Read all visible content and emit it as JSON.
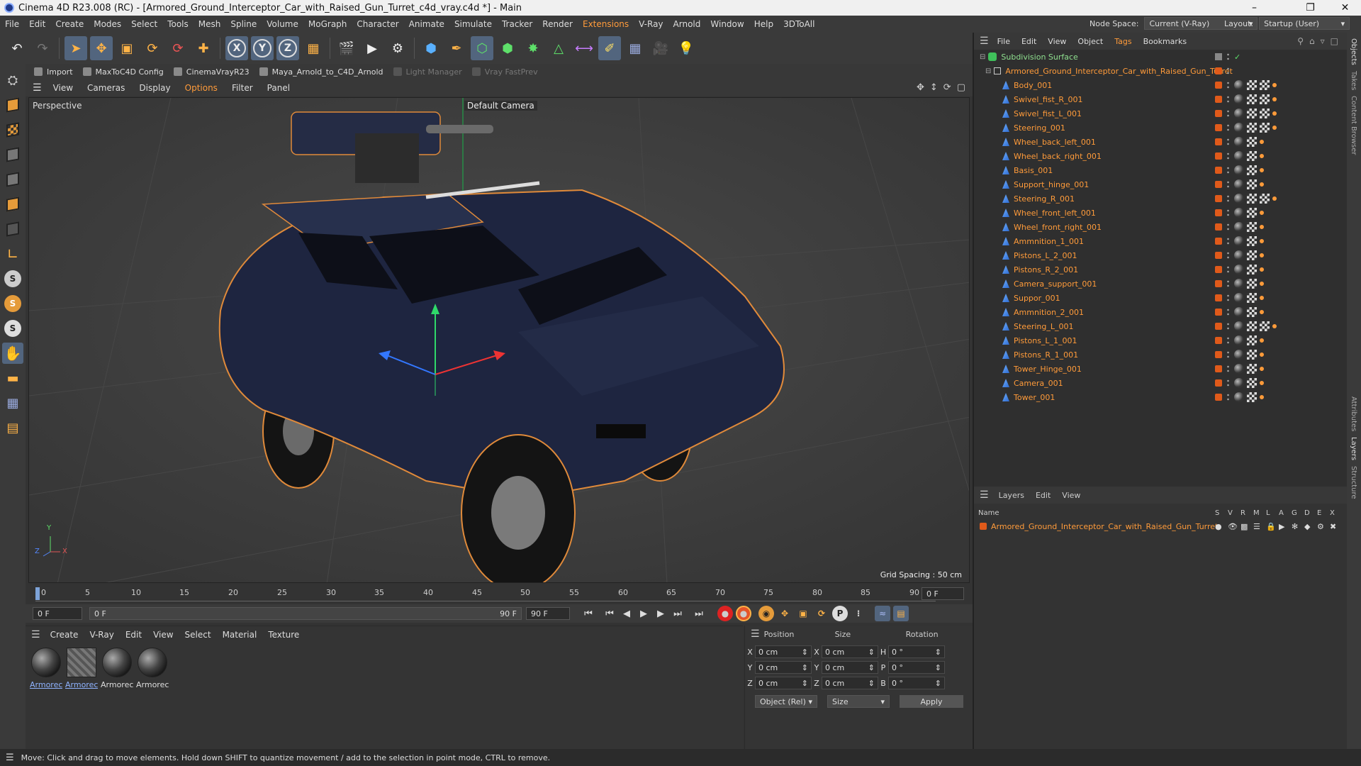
{
  "window": {
    "title": "Cinema 4D R23.008 (RC) - [Armored_Ground_Interceptor_Car_with_Raised_Gun_Turret_c4d_vray.c4d *] - Main"
  },
  "menubar": {
    "items": [
      {
        "label": "File"
      },
      {
        "label": "Edit"
      },
      {
        "label": "Create"
      },
      {
        "label": "Modes"
      },
      {
        "label": "Select"
      },
      {
        "label": "Tools"
      },
      {
        "label": "Mesh"
      },
      {
        "label": "Spline"
      },
      {
        "label": "Volume"
      },
      {
        "label": "MoGraph"
      },
      {
        "label": "Character"
      },
      {
        "label": "Animate"
      },
      {
        "label": "Simulate"
      },
      {
        "label": "Tracker"
      },
      {
        "label": "Render"
      },
      {
        "label": "Extensions"
      },
      {
        "label": "V-Ray"
      },
      {
        "label": "Arnold"
      },
      {
        "label": "Window"
      },
      {
        "label": "Help"
      },
      {
        "label": "3DToAll"
      }
    ],
    "node_space_label": "Node Space:",
    "node_space_value": "Current (V-Ray)",
    "layout_label": "Layout:",
    "layout_value": "Startup (User)"
  },
  "plugins": [
    {
      "label": "Import",
      "enabled": true
    },
    {
      "label": "MaxToC4D Config",
      "enabled": true
    },
    {
      "label": "CinemaVrayR23",
      "enabled": true
    },
    {
      "label": "Maya_Arnold_to_C4D_Arnold",
      "enabled": true
    },
    {
      "label": "Light Manager",
      "enabled": false
    },
    {
      "label": "Vray FastPrev",
      "enabled": false
    }
  ],
  "viewport_menu": [
    {
      "label": "View"
    },
    {
      "label": "Cameras"
    },
    {
      "label": "Display"
    },
    {
      "label": "Options"
    },
    {
      "label": "Filter"
    },
    {
      "label": "Panel"
    }
  ],
  "viewport": {
    "projection": "Perspective",
    "camera": "Default Camera",
    "grid_spacing": "Grid Spacing : 50 cm",
    "axis_labels": {
      "x": "X",
      "y": "Y",
      "z": "Z"
    }
  },
  "timeline": {
    "ticks": [
      "0",
      "5",
      "10",
      "15",
      "20",
      "25",
      "30",
      "35",
      "40",
      "45",
      "50",
      "55",
      "60",
      "65",
      "70",
      "75",
      "80",
      "85",
      "90"
    ],
    "end_field": "0 F"
  },
  "transport": {
    "start_frame": "0 F",
    "range_start": "0 F",
    "range_end": "90 F",
    "end_frame": "90 F"
  },
  "material_panel": {
    "menu": [
      {
        "label": "Create"
      },
      {
        "label": "V-Ray"
      },
      {
        "label": "Edit"
      },
      {
        "label": "View"
      },
      {
        "label": "Select"
      },
      {
        "label": "Material"
      },
      {
        "label": "Texture"
      }
    ],
    "materials": [
      {
        "label": "Armorec"
      },
      {
        "label": "Armorec"
      },
      {
        "label": "Armorec"
      },
      {
        "label": "Armorec"
      }
    ]
  },
  "coordinates": {
    "headers": {
      "position": "Position",
      "size": "Size",
      "rotation": "Rotation"
    },
    "rows": [
      {
        "axis": "X",
        "pos": "0 cm",
        "size_axis": "X",
        "size": "0 cm",
        "rot_axis": "H",
        "rot": "0 °"
      },
      {
        "axis": "Y",
        "pos": "0 cm",
        "size_axis": "Y",
        "size": "0 cm",
        "rot_axis": "P",
        "rot": "0 °"
      },
      {
        "axis": "Z",
        "pos": "0 cm",
        "size_axis": "Z",
        "size": "0 cm",
        "rot_axis": "B",
        "rot": "0 °"
      }
    ],
    "mode": "Object (Rel)",
    "size_mode": "Size",
    "apply": "Apply"
  },
  "object_manager": {
    "menu": [
      {
        "label": "File"
      },
      {
        "label": "Edit"
      },
      {
        "label": "View"
      },
      {
        "label": "Object"
      },
      {
        "label": "Tags"
      },
      {
        "label": "Bookmarks"
      }
    ],
    "root": "Subdivision Surface",
    "group": "Armored_Ground_Interceptor_Car_with_Raised_Gun_Turret",
    "objects": [
      {
        "name": "Body_001"
      },
      {
        "name": "Swivel_fist_R_001"
      },
      {
        "name": "Swivel_fist_L_001"
      },
      {
        "name": "Steering_001"
      },
      {
        "name": "Wheel_back_left_001"
      },
      {
        "name": "Wheel_back_right_001"
      },
      {
        "name": "Basis_001"
      },
      {
        "name": "Support_hinge_001"
      },
      {
        "name": "Steering_R_001"
      },
      {
        "name": "Wheel_front_left_001"
      },
      {
        "name": "Wheel_front_right_001"
      },
      {
        "name": "Ammnition_1_001"
      },
      {
        "name": "Pistons_L_2_001"
      },
      {
        "name": "Pistons_R_2_001"
      },
      {
        "name": "Camera_support_001"
      },
      {
        "name": "Suppor_001"
      },
      {
        "name": "Ammnition_2_001"
      },
      {
        "name": "Steering_L_001"
      },
      {
        "name": "Pistons_L_1_001"
      },
      {
        "name": "Pistons_R_1_001"
      },
      {
        "name": "Tower_Hinge_001"
      },
      {
        "name": "Camera_001"
      },
      {
        "name": "Tower_001"
      }
    ]
  },
  "layer_manager": {
    "menu": [
      {
        "label": "Layers"
      },
      {
        "label": "Edit"
      },
      {
        "label": "View"
      }
    ],
    "name_header": "Name",
    "flags": [
      "S",
      "V",
      "R",
      "M",
      "L",
      "A",
      "G",
      "D",
      "E",
      "X"
    ],
    "layer_name": "Armored_Ground_Interceptor_Car_with_Raised_Gun_Turret"
  },
  "side_tabs": [
    {
      "label": "Objects"
    },
    {
      "label": "Takes"
    },
    {
      "label": "Content Browser"
    },
    {
      "label": "Attributes"
    },
    {
      "label": "Layers"
    },
    {
      "label": "Structure"
    }
  ],
  "status": {
    "text": "Move: Click and drag to move elements. Hold down SHIFT to quantize movement / add to the selection in point mode, CTRL to remove."
  },
  "colors": {
    "accent": "#ff9b3a",
    "selection": "#52657e",
    "car_body": "#1e2540"
  }
}
